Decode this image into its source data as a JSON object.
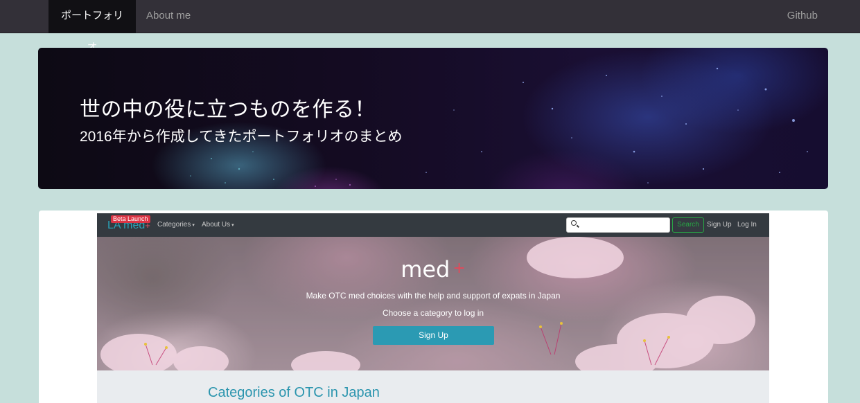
{
  "navbar": {
    "items": [
      {
        "label": "ポートフォリオ",
        "active": true
      },
      {
        "label": "About me",
        "active": false
      }
    ],
    "right_link": "Github"
  },
  "hero": {
    "title": "世の中の役に立つものを作る！",
    "subtitle": "2016年から作成してきたポートフォリオのまとめ"
  },
  "portfolio_item": {
    "screenshot": {
      "nav": {
        "logo": "LA med",
        "logo_plus": "+",
        "beta_badge": "Beta Launch",
        "links": [
          "Categories",
          "About Us"
        ],
        "search_button": "Search",
        "sign_up": "Sign Up",
        "log_in": "Log In"
      },
      "hero": {
        "brand": "med",
        "brand_plus": "+",
        "tagline": "Make OTC med choices with the help and support of expats in Japan",
        "prompt": "Choose a category to log in",
        "signup_button": "Sign Up"
      },
      "section_title": "Categories of OTC in Japan"
    }
  },
  "colors": {
    "page_bg": "#c6dfdb",
    "navbar_bg": "#333038",
    "accent_teal": "#2b9ab3",
    "beta_red": "#dc3545",
    "search_green": "#28a745"
  }
}
